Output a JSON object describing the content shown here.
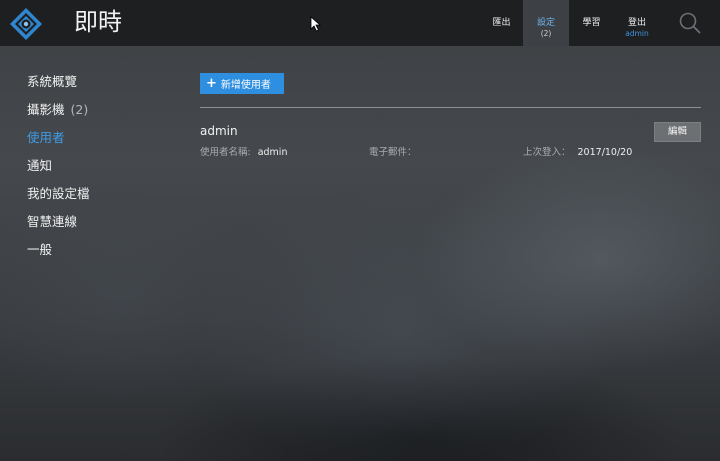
{
  "app": {
    "title": "即時"
  },
  "nav": {
    "export": {
      "label": "匯出"
    },
    "settings": {
      "label": "設定",
      "sub": "(2)"
    },
    "learn": {
      "label": "學習"
    },
    "logout": {
      "label": "登出",
      "sub": "admin"
    }
  },
  "sidebar": {
    "items": [
      {
        "label": "系統概覽",
        "count": ""
      },
      {
        "label": "攝影機",
        "count": "(2)"
      },
      {
        "label": "使用者",
        "count": ""
      },
      {
        "label": "通知",
        "count": ""
      },
      {
        "label": "我的設定檔",
        "count": ""
      },
      {
        "label": "智慧連線",
        "count": ""
      },
      {
        "label": "一般",
        "count": ""
      }
    ],
    "active_index": 2
  },
  "main": {
    "add_user_label": "新增使用者",
    "users": [
      {
        "name": "admin",
        "username_label": "使用者名稱:",
        "username": "admin",
        "email_label": "電子郵件：",
        "email": "",
        "last_login_label": "上次登入：",
        "last_login": "2017/10/20",
        "edit_label": "編輯"
      }
    ]
  },
  "colors": {
    "accent": "#2e8fe0",
    "active_nav_text": "#6fb2ea",
    "topbar": "#1e1f21"
  },
  "icons": [
    "app-logo-icon",
    "plus-icon",
    "search-icon",
    "mouse-cursor-icon"
  ]
}
